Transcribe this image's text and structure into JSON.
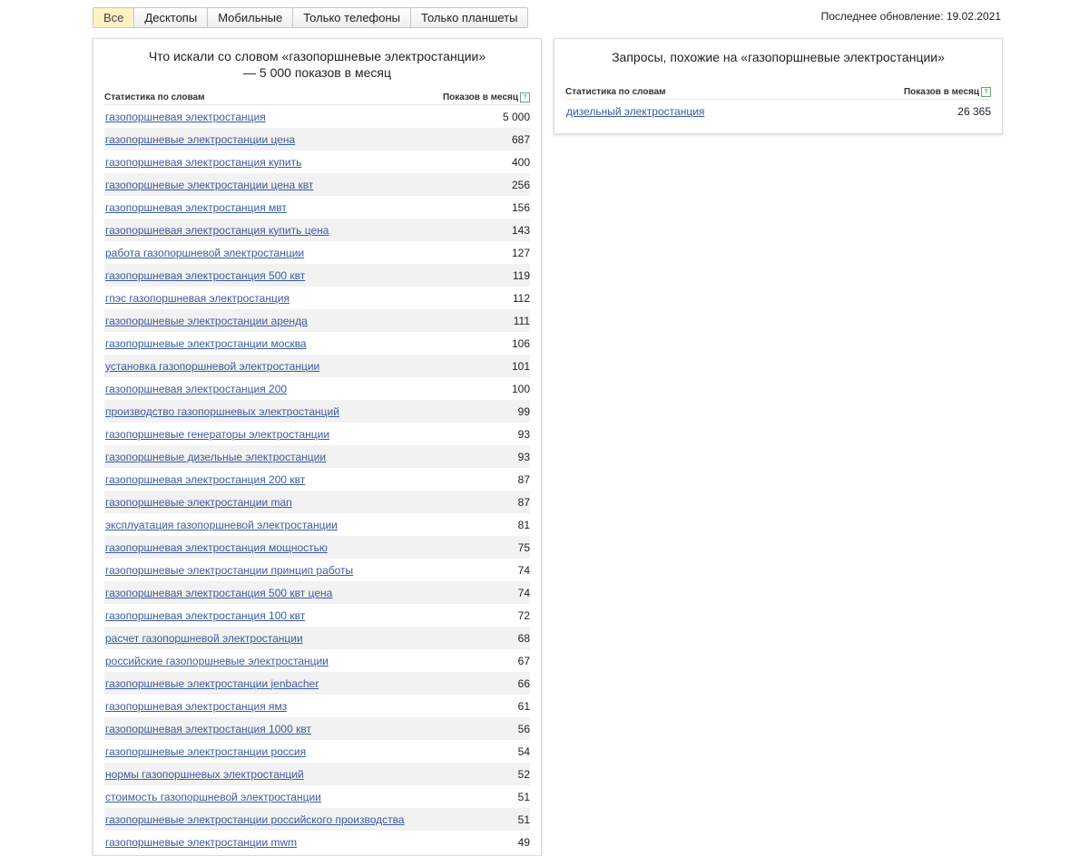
{
  "tabs": [
    "Все",
    "Десктопы",
    "Мобильные",
    "Только телефоны",
    "Только планшеты"
  ],
  "active_tab": "Все",
  "last_update": "Последнее обновление: 19.02.2021",
  "left_panel": {
    "title": "Что искали со словом «газопоршневые электростанции» — 5 000 показов в месяц",
    "col_phrase": "Статистика по словам",
    "col_count": "Показов в месяц",
    "rows": [
      {
        "phrase": "газопоршневая электростанция",
        "count": "5 000"
      },
      {
        "phrase": "газопоршневые электростанции цена",
        "count": "687"
      },
      {
        "phrase": "газопоршневая электростанция купить",
        "count": "400"
      },
      {
        "phrase": "газопоршневые электростанции цена квт",
        "count": "256"
      },
      {
        "phrase": "газопоршневая электростанция мвт",
        "count": "156"
      },
      {
        "phrase": "газопоршневая электростанция купить цена",
        "count": "143"
      },
      {
        "phrase": "работа газопоршневой электростанции",
        "count": "127"
      },
      {
        "phrase": "газопоршневая электростанция 500 квт",
        "count": "119"
      },
      {
        "phrase": "гпэс газопоршневая электростанция",
        "count": "112"
      },
      {
        "phrase": "газопоршневые электростанции аренда",
        "count": "111"
      },
      {
        "phrase": "газопоршневые электростанции москва",
        "count": "106"
      },
      {
        "phrase": "установка газопоршневой электростанции",
        "count": "101"
      },
      {
        "phrase": "газопоршневая электростанция 200",
        "count": "100"
      },
      {
        "phrase": "производство газопоршневых электростанций",
        "count": "99"
      },
      {
        "phrase": "газопоршневые генераторы электростанции",
        "count": "93"
      },
      {
        "phrase": "газопоршневые дизельные электростанции",
        "count": "93"
      },
      {
        "phrase": "газопоршневая электростанция 200 квт",
        "count": "87"
      },
      {
        "phrase": "газопоршневые электростанции man",
        "count": "87"
      },
      {
        "phrase": "эксплуатация газопоршневой электростанции",
        "count": "81"
      },
      {
        "phrase": "газопоршневая электростанция мощностью",
        "count": "75"
      },
      {
        "phrase": "газопоршневые электростанции принцип работы",
        "count": "74"
      },
      {
        "phrase": "газопоршневая электростанция 500 квт цена",
        "count": "74"
      },
      {
        "phrase": "газопоршневая электростанция 100 квт",
        "count": "72"
      },
      {
        "phrase": "расчет газопоршневой электростанции",
        "count": "68"
      },
      {
        "phrase": "российские газопоршневые электростанции",
        "count": "67"
      },
      {
        "phrase": "газопоршневые электростанции jenbacher",
        "count": "66"
      },
      {
        "phrase": "газопоршневая электростанция ямз",
        "count": "61"
      },
      {
        "phrase": "газопоршневая электростанция 1000 квт",
        "count": "56"
      },
      {
        "phrase": "газопоршневые электростанции россия",
        "count": "54"
      },
      {
        "phrase": "нормы газопоршневых электростанций",
        "count": "52"
      },
      {
        "phrase": "стоимость газопоршневой электростанции",
        "count": "51"
      },
      {
        "phrase": "газопоршневые электростанции российского производства",
        "count": "51"
      },
      {
        "phrase": "газопоршневые электростанции mwm",
        "count": "49"
      }
    ]
  },
  "right_panel": {
    "title": "Запросы, похожие на «газопоршневые электростанции»",
    "col_phrase": "Статистика по словам",
    "col_count": "Показов в месяц",
    "rows": [
      {
        "phrase": "дизельный электростанция",
        "count": "26 365"
      }
    ]
  },
  "colors": {
    "link": "#3b5a9d",
    "active_tab_bg": "#fff1c4",
    "row_alt": "#f2f2f2"
  },
  "icons": {
    "help": "question-icon"
  }
}
